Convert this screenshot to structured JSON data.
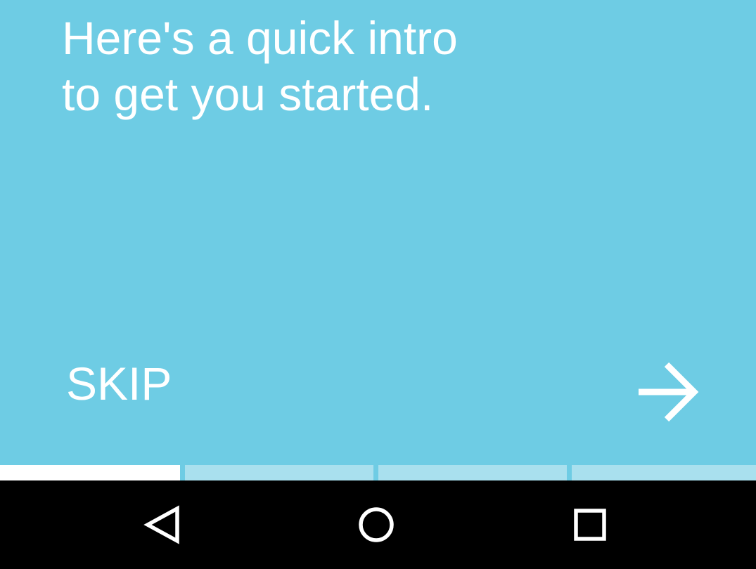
{
  "intro": {
    "line1": "Here's a quick intro",
    "line2": "to get you started."
  },
  "actions": {
    "skip_label": "SKIP",
    "next_icon": "arrow-right-icon"
  },
  "progress": {
    "total_pages": 4,
    "current_page": 1
  },
  "navbar": {
    "back_icon": "triangle-back-icon",
    "home_icon": "circle-home-icon",
    "recents_icon": "square-recents-icon"
  },
  "colors": {
    "background": "#6ECCE4",
    "text": "#FFFFFF",
    "progress_active": "#FFFFFF",
    "progress_inactive": "#A9E0EE",
    "navbar": "#000000"
  }
}
